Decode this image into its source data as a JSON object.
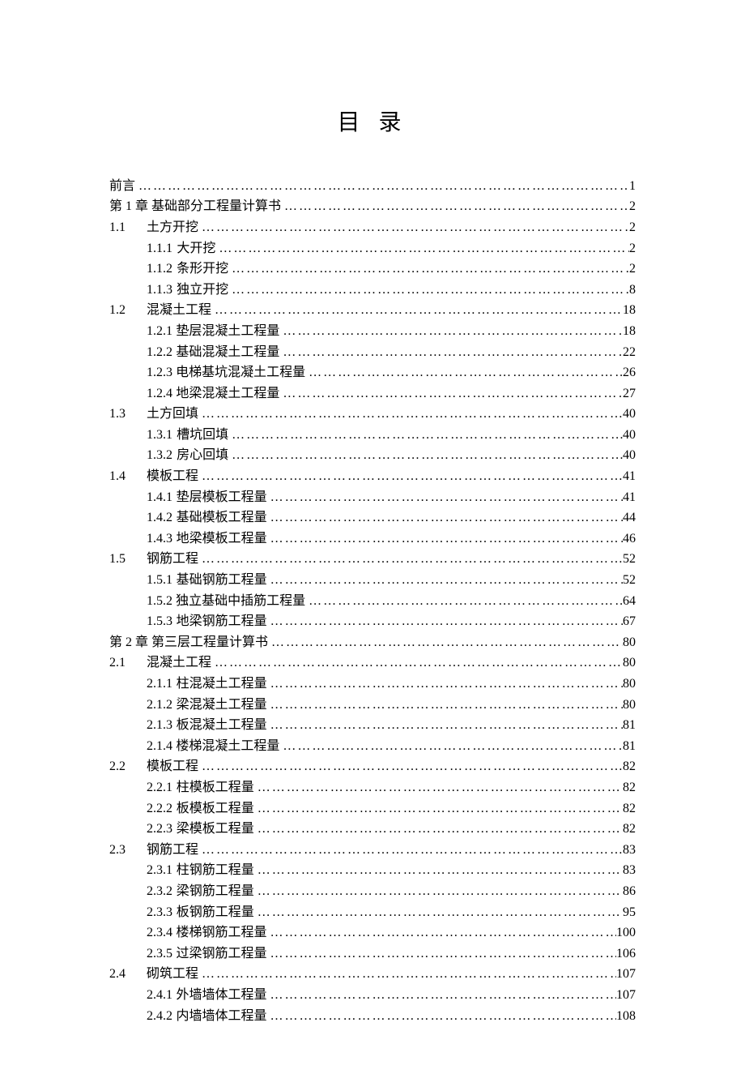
{
  "title": "目 录",
  "entries": [
    {
      "level": 0,
      "num": "",
      "label": "前言",
      "page": "1"
    },
    {
      "level": 0,
      "num": "",
      "label": "第 1 章 基础部分工程量计算书",
      "page": "2"
    },
    {
      "level": 1,
      "num": "1.1",
      "label": "土方开挖",
      "page": "2"
    },
    {
      "level": 2,
      "num": "1.1.1",
      "label": "大开挖",
      "page": "2"
    },
    {
      "level": 2,
      "num": "1.1.2",
      "label": "条形开挖",
      "page": "2"
    },
    {
      "level": 2,
      "num": "1.1.3",
      "label": "独立开挖",
      "page": "8"
    },
    {
      "level": 1,
      "num": "1.2",
      "label": "混凝土工程",
      "page": "18"
    },
    {
      "level": 2,
      "num": "1.2.1",
      "label": "垫层混凝土工程量",
      "page": "18"
    },
    {
      "level": 2,
      "num": "1.2.2",
      "label": "基础混凝土工程量",
      "page": "22"
    },
    {
      "level": 2,
      "num": "1.2.3",
      "label": "电梯基坑混凝土工程量",
      "page": "26"
    },
    {
      "level": 2,
      "num": "1.2.4",
      "label": "地梁混凝土工程量",
      "page": "27"
    },
    {
      "level": 1,
      "num": "1.3",
      "label": "土方回填",
      "page": "40"
    },
    {
      "level": 2,
      "num": "1.3.1",
      "label": "槽坑回填",
      "page": "40"
    },
    {
      "level": 2,
      "num": "1.3.2",
      "label": "房心回填",
      "page": "40"
    },
    {
      "level": 1,
      "num": "1.4",
      "label": "模板工程",
      "page": "41"
    },
    {
      "level": 2,
      "num": "1.4.1",
      "label": "垫层模板工程量",
      "page": "41"
    },
    {
      "level": 2,
      "num": "1.4.2",
      "label": "基础模板工程量",
      "page": "44"
    },
    {
      "level": 2,
      "num": "1.4.3",
      "label": "地梁模板工程量",
      "page": "46"
    },
    {
      "level": 1,
      "num": "1.5",
      "label": "钢筋工程",
      "page": "52"
    },
    {
      "level": 2,
      "num": "1.5.1",
      "label": "基础钢筋工程量",
      "page": "52"
    },
    {
      "level": 2,
      "num": "1.5.2",
      "label": "独立基础中插筋工程量",
      "page": "64"
    },
    {
      "level": 2,
      "num": "1.5.3",
      "label": "地梁钢筋工程量",
      "page": "67"
    },
    {
      "level": 0,
      "num": "",
      "label": "第 2 章 第三层工程量计算书",
      "page": "80"
    },
    {
      "level": 1,
      "num": "2.1",
      "label": "混凝土工程",
      "page": "80"
    },
    {
      "level": 2,
      "num": "2.1.1",
      "label": "柱混凝土工程量",
      "page": "80"
    },
    {
      "level": 2,
      "num": "2.1.2",
      "label": "梁混凝土工程量",
      "page": "80"
    },
    {
      "level": 2,
      "num": "2.1.3",
      "label": "板混凝土工程量",
      "page": "81"
    },
    {
      "level": 2,
      "num": "2.1.4",
      "label": "楼梯混凝土工程量",
      "page": "81"
    },
    {
      "level": 1,
      "num": "2.2",
      "label": "模板工程",
      "page": "82"
    },
    {
      "level": 2,
      "num": "2.2.1",
      "label": "柱模板工程量",
      "page": "82"
    },
    {
      "level": 2,
      "num": "2.2.2",
      "label": "板模板工程量",
      "page": "82"
    },
    {
      "level": 2,
      "num": "2.2.3",
      "label": "梁模板工程量",
      "page": "82"
    },
    {
      "level": 1,
      "num": "2.3",
      "label": "钢筋工程",
      "page": "83"
    },
    {
      "level": 2,
      "num": "2.3.1",
      "label": "柱钢筋工程量",
      "page": "83"
    },
    {
      "level": 2,
      "num": "2.3.2",
      "label": "梁钢筋工程量",
      "page": "86"
    },
    {
      "level": 2,
      "num": "2.3.3",
      "label": "板钢筋工程量",
      "page": "95"
    },
    {
      "level": 2,
      "num": "2.3.4",
      "label": "楼梯钢筋工程量",
      "page": "100"
    },
    {
      "level": 2,
      "num": "2.3.5",
      "label": "过梁钢筋工程量",
      "page": "106"
    },
    {
      "level": 1,
      "num": "2.4",
      "label": "砌筑工程",
      "page": "107"
    },
    {
      "level": 2,
      "num": "2.4.1",
      "label": "外墙墙体工程量",
      "page": "107"
    },
    {
      "level": 2,
      "num": "2.4.2",
      "label": "内墙墙体工程量",
      "page": "108"
    }
  ]
}
